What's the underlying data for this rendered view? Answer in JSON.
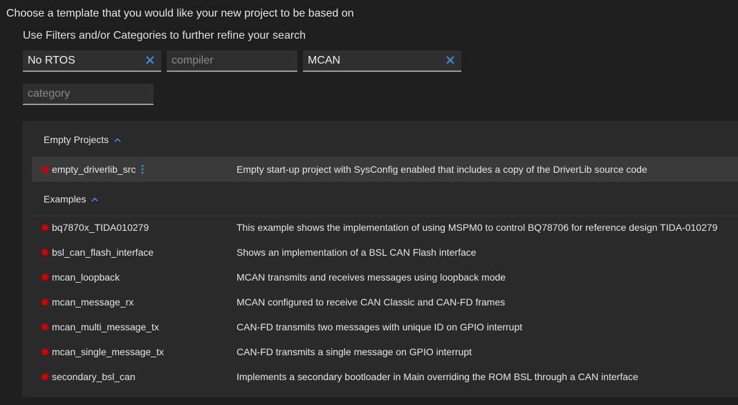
{
  "heading": "Choose a template that you would like your new project to be based on",
  "subheading": "Use Filters and/or Categories to further refine your search",
  "filters": {
    "rtos": {
      "value": "No RTOS"
    },
    "compiler": {
      "placeholder": "compiler"
    },
    "search": {
      "value": "MCAN"
    },
    "category": {
      "placeholder": "category"
    }
  },
  "accent_color": "#3d8fe0",
  "status_color": "#cc0000",
  "groups": {
    "empty": {
      "label": "Empty Projects",
      "items": [
        {
          "name": "empty_driverlib_src",
          "description": "Empty start-up project with SysConfig enabled that includes a copy of the DriverLib source code"
        }
      ]
    },
    "examples": {
      "label": "Examples",
      "items": [
        {
          "name": "bq7870x_TIDA010279",
          "description": "This example shows the implementation of using MSPM0 to control BQ78706 for reference design TIDA-010279"
        },
        {
          "name": "bsl_can_flash_interface",
          "description": "Shows an implementation of a BSL CAN Flash interface"
        },
        {
          "name": "mcan_loopback",
          "description": "MCAN transmits and receives messages using loopback mode"
        },
        {
          "name": "mcan_message_rx",
          "description": "MCAN configured to receive CAN Classic and CAN-FD frames"
        },
        {
          "name": "mcan_multi_message_tx",
          "description": "CAN-FD transmits two messages with unique ID on GPIO interrupt"
        },
        {
          "name": "mcan_single_message_tx",
          "description": "CAN-FD transmits a single message on GPIO interrupt"
        },
        {
          "name": "secondary_bsl_can",
          "description": "Implements a secondary bootloader in Main overriding the ROM BSL through a CAN interface"
        }
      ]
    }
  }
}
